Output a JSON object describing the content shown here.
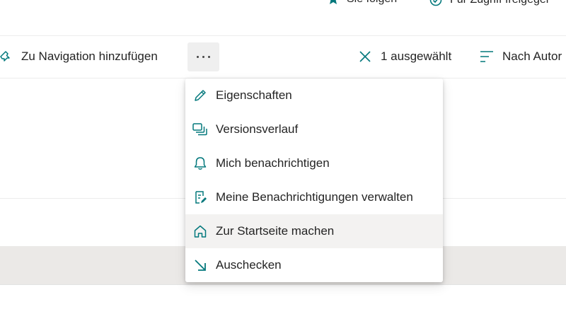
{
  "top_bar": {
    "follow_label": "Sie folgen",
    "share_label": "Für Zugriff freigeger"
  },
  "command_bar": {
    "add_to_nav_label": "Zu Navigation hinzufügen",
    "more_label": "···",
    "selected_label": "1 ausgewählt",
    "sort_label": "Nach Autor"
  },
  "menu": {
    "items": [
      {
        "label": "Eigenschaften",
        "icon": "pencil-icon"
      },
      {
        "label": "Versionsverlauf",
        "icon": "versions-icon"
      },
      {
        "label": "Mich benachrichtigen",
        "icon": "bell-icon"
      },
      {
        "label": "Meine Benachrichtigungen verwalten",
        "icon": "manage-alerts-icon"
      },
      {
        "label": "Zur Startseite machen",
        "icon": "home-icon"
      },
      {
        "label": "Auschecken",
        "icon": "checkout-arrow-icon"
      }
    ],
    "highlighted_index": 4
  },
  "colors": {
    "accent": "#03787c",
    "hover": "#f3f2f1",
    "text": "#242424"
  }
}
